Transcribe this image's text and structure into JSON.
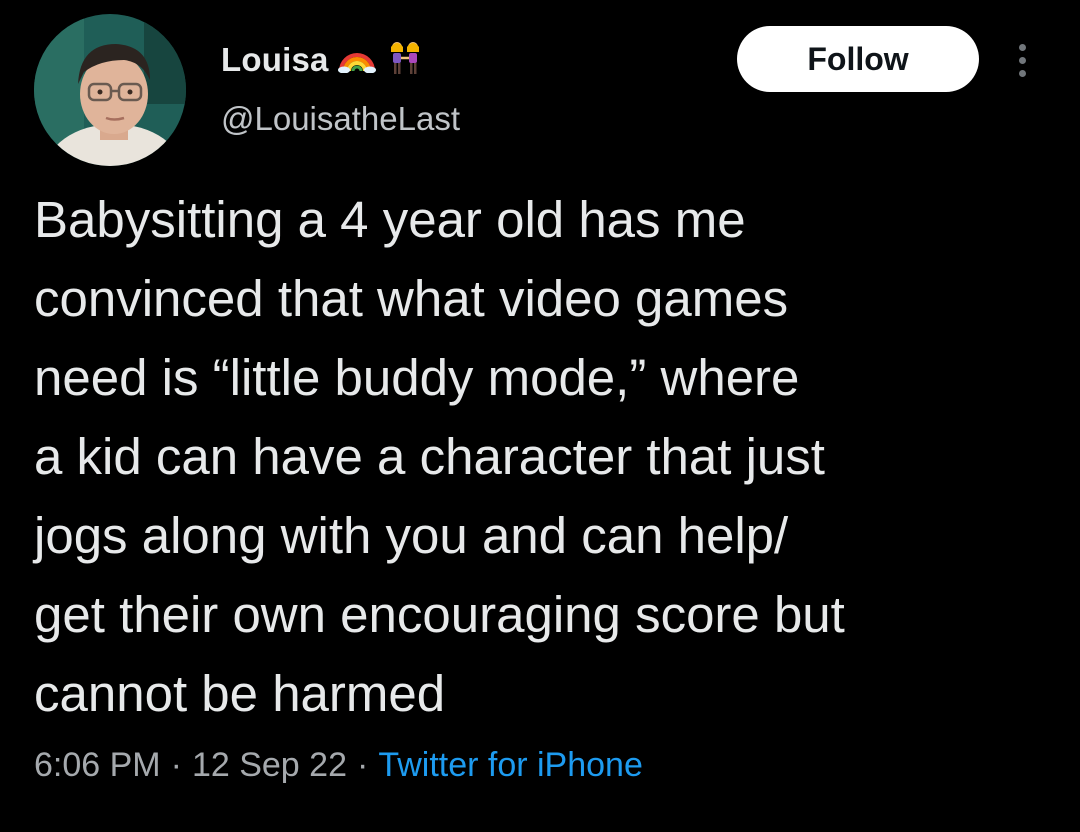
{
  "user": {
    "display_name": "Louisa",
    "handle": "@LouisatheLast",
    "name_emojis": [
      "rainbow-emoji",
      "two-women-holding-hands-emoji"
    ]
  },
  "actions": {
    "follow_label": "Follow",
    "more_icon": "more-vertical-icon"
  },
  "tweet": {
    "text_lines": [
      "Babysitting a 4 year old has me",
      "convinced that what video games",
      "need is “little buddy mode,” where",
      "a kid can have a character that just",
      "jogs along with you and can help/",
      "get their own encouraging score but",
      "cannot be harmed"
    ]
  },
  "meta": {
    "time": "6:06 PM",
    "separator": "·",
    "date": "12 Sep 22",
    "source": "Twitter for iPhone"
  },
  "colors": {
    "background": "#000000",
    "text": "#e7e9ea",
    "secondary": "#a5a9ad",
    "link": "#1d9bf0",
    "follow_bg": "#ffffff"
  }
}
